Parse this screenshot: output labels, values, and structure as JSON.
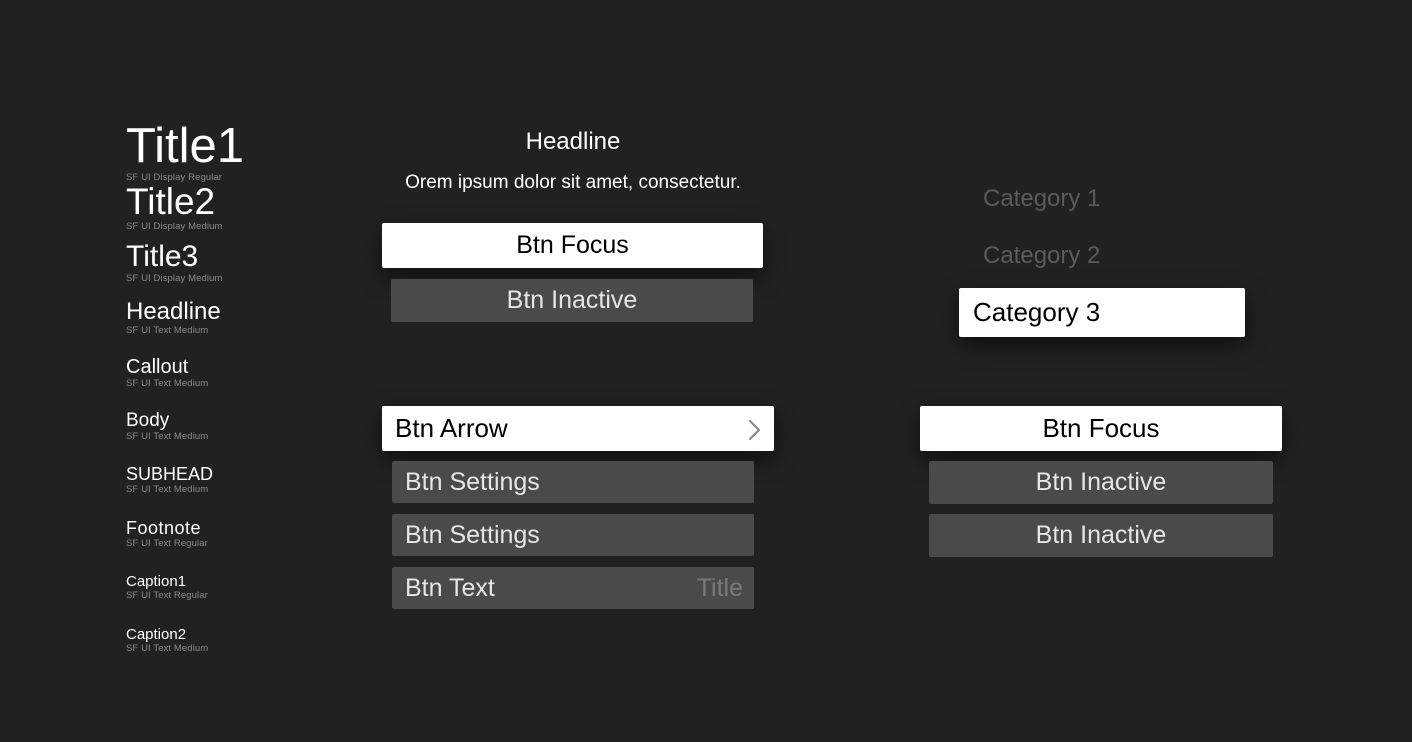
{
  "type_specimens": [
    {
      "name": "Title1",
      "font": "SF UI Display Regular"
    },
    {
      "name": "Title2",
      "font": "SF UI Display Medium"
    },
    {
      "name": "Title3",
      "font": "SF UI Display Medium"
    },
    {
      "name": "Headline",
      "font": "SF UI Text Medium"
    },
    {
      "name": "Callout",
      "font": "SF UI Text Medium"
    },
    {
      "name": "Body",
      "font": "SF UI Text Medium"
    },
    {
      "name": "SUBHEAD",
      "font": "SF UI Text Medium"
    },
    {
      "name": "Footnote",
      "font": "SF UI Text Regular"
    },
    {
      "name": "Caption1",
      "font": "SF UI Text Regular"
    },
    {
      "name": "Caption2",
      "font": "SF UI Text Medium"
    }
  ],
  "alert": {
    "headline": "Headline",
    "body": "Orem ipsum dolor sit amet, consectetur.",
    "focus_button": "Btn Focus",
    "inactive_button": "Btn Inactive"
  },
  "settings_buttons": {
    "arrow_label": "Btn Arrow",
    "settings_label_1": "Btn Settings",
    "settings_label_2": "Btn Settings",
    "text_label": "Btn Text",
    "text_value": "Title",
    "arrow_icon": "chevron-right-icon"
  },
  "categories": {
    "items": [
      "Category 1",
      "Category 2",
      "Category 3"
    ],
    "selected": "Category 3"
  },
  "action_buttons": {
    "focus_label": "Btn Focus",
    "inactive_label_1": "Btn Inactive",
    "inactive_label_2": "Btn Inactive"
  },
  "colors": {
    "background": "#212121",
    "focus_fill": "#ffffff",
    "inactive_fill": "#4a4a4a",
    "muted_text": "#5b5b5b"
  }
}
